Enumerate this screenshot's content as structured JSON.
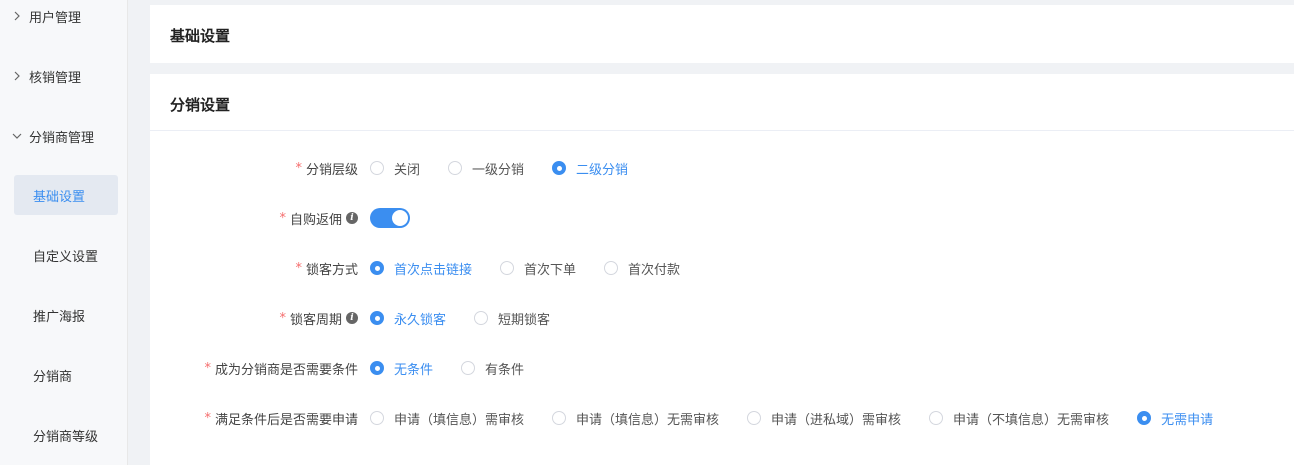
{
  "sidebar": {
    "groups": [
      {
        "label": "用户管理"
      },
      {
        "label": "核销管理"
      },
      {
        "label": "分销商管理"
      }
    ],
    "items": [
      {
        "label": "基础设置"
      },
      {
        "label": "自定义设置"
      },
      {
        "label": "推广海报"
      },
      {
        "label": "分销商"
      },
      {
        "label": "分销商等级"
      }
    ]
  },
  "panels": {
    "basic_title": "基础设置",
    "distribution_title": "分销设置"
  },
  "form": {
    "required_mark": "*",
    "level": {
      "label": "分销层级",
      "options": [
        "关闭",
        "一级分销",
        "二级分销"
      ],
      "selected": 2
    },
    "self_rebate": {
      "label": "自购返佣",
      "info": "i",
      "enabled": true
    },
    "lock_method": {
      "label": "锁客方式",
      "options": [
        "首次点击链接",
        "首次下单",
        "首次付款"
      ],
      "selected": 0
    },
    "lock_period": {
      "label": "锁客周期",
      "info": "i",
      "options": [
        "永久锁客",
        "短期锁客"
      ],
      "selected": 0
    },
    "condition": {
      "label": "成为分销商是否需要条件",
      "options": [
        "无条件",
        "有条件"
      ],
      "selected": 0
    },
    "apply": {
      "label": "满足条件后是否需要申请",
      "options": [
        "申请（填信息）需审核",
        "申请（填信息）无需审核",
        "申请（进私域）需审核",
        "申请（不填信息）无需审核",
        "无需申请"
      ],
      "selected": 4
    }
  }
}
